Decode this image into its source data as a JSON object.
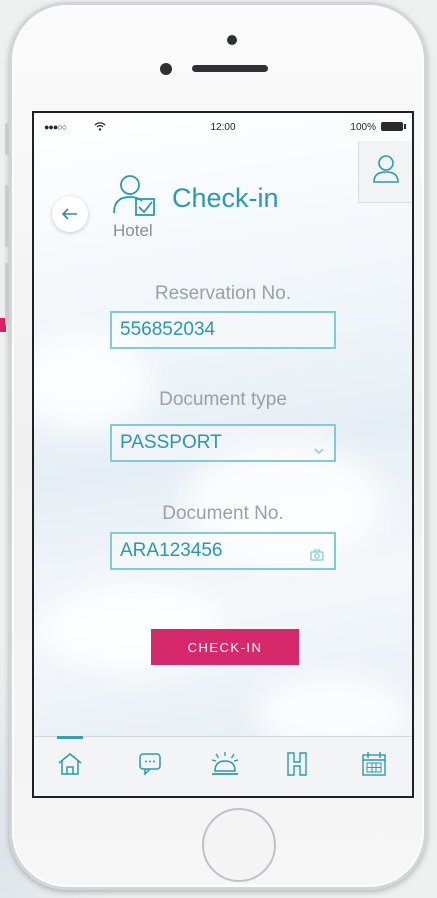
{
  "status_bar": {
    "signal": "●●●○○",
    "time": "12:00",
    "battery": "100%"
  },
  "screen": {
    "title": "Check-in",
    "subtitle": "Hotel",
    "icons": {
      "back": "arrow-left-icon",
      "title": "user-check-icon",
      "profile": "user-icon"
    }
  },
  "form": {
    "reservation": {
      "label": "Reservation No.",
      "value": "556852034"
    },
    "document_type": {
      "label": "Document type",
      "value": "PASSPORT"
    },
    "document_no": {
      "label": "Document No.",
      "value": "ARA123456"
    }
  },
  "actions": {
    "checkin_label": "CHECK-IN"
  },
  "tabbar": {
    "items": [
      "home-icon",
      "chat-icon",
      "service-bell-icon",
      "hotel-icon",
      "calendar-icon"
    ],
    "active": "home-icon"
  },
  "colors": {
    "accent": "#2a9ab0",
    "field_border": "#7fcbd6",
    "button": "#d6296c"
  }
}
